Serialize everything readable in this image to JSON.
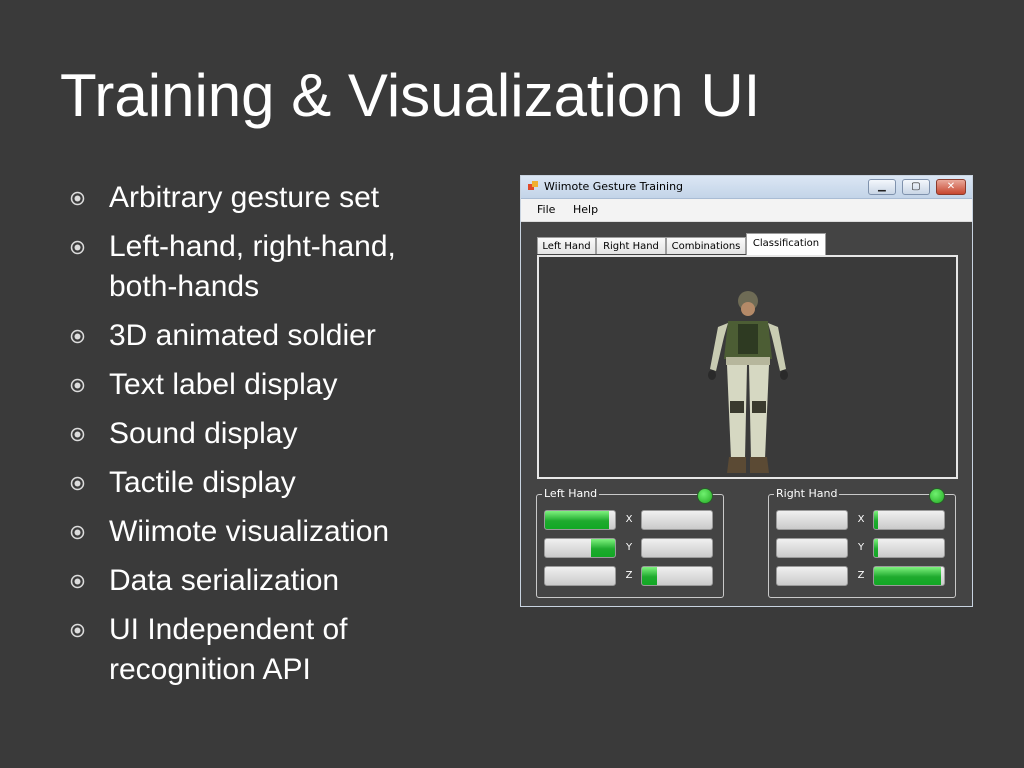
{
  "slide": {
    "title": "Training & Visualization UI",
    "bullets": [
      {
        "line1": "Arbitrary gesture set",
        "line2": ""
      },
      {
        "line1": "Left-hand, right-hand,",
        "line2": "both-hands"
      },
      {
        "line1": "3D animated soldier",
        "line2": ""
      },
      {
        "line1": "Text label display",
        "line2": ""
      },
      {
        "line1": "Sound display",
        "line2": ""
      },
      {
        "line1": "Tactile display",
        "line2": ""
      },
      {
        "line1": "Wiimote visualization",
        "line2": ""
      },
      {
        "line1": "Data serialization",
        "line2": ""
      },
      {
        "line1": "UI Independent of",
        "line2": "recognition API"
      }
    ],
    "bullet_icon": "circled-dot-icon"
  },
  "window": {
    "title": "Wiimote Gesture Training",
    "controls": {
      "minimize": "minimize-icon",
      "maximize": "maximize-icon",
      "close": "close-icon"
    },
    "menu": [
      "File",
      "Help"
    ],
    "tabs": [
      "Left Hand",
      "Right Hand",
      "Combinations",
      "Classification"
    ],
    "active_tab": "Classification",
    "left_panel": {
      "label": "Left Hand",
      "status_color": "#22aa22",
      "axes": [
        "X",
        "Y",
        "Z"
      ],
      "accel": [
        0.92,
        0.35,
        0.0
      ],
      "gyro": [
        0.0,
        0.0,
        0.22
      ]
    },
    "right_panel": {
      "label": "Right Hand",
      "status_color": "#22aa22",
      "axes": [
        "X",
        "Y",
        "Z"
      ],
      "accel": [
        0.0,
        0.0,
        0.0
      ],
      "gyro": [
        0.06,
        0.06,
        0.95
      ]
    }
  },
  "colors": {
    "background": "#3a3a3a",
    "text": "#ffffff",
    "meter_fill": "#22bb33"
  }
}
